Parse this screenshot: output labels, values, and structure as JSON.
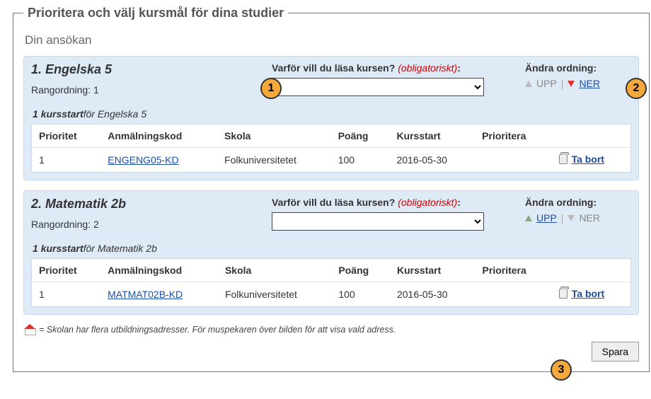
{
  "page": {
    "legend": "Prioritera och välj kursmål för dina studier",
    "subheading": "Din ansökan",
    "footnote_text": "= Skolan har flera utbildningsadresser. För muspekaren över bilden för att visa vald adress.",
    "save_label": "Spara"
  },
  "labels": {
    "question": "Varför vill du läsa kursen?",
    "obligatory": "(obligatoriskt)",
    "change_order": "Ändra ordning:",
    "up": "UPP",
    "down": "NER",
    "rank_prefix": "Rangordning:",
    "remove": "Ta bort",
    "kursstart_count_word": "kursstart",
    "kursstart_for": "för"
  },
  "columns": {
    "priority": "Prioritet",
    "code": "Anmälningskod",
    "school": "Skola",
    "points": "Poäng",
    "start": "Kursstart",
    "prioritize": "Prioritera"
  },
  "courses": [
    {
      "index": "1",
      "title": "1. Engelska 5",
      "name": "Engelska 5",
      "rank": "1",
      "kursstart_count": "1",
      "up_enabled": false,
      "down_enabled": true,
      "rows": [
        {
          "priority": "1",
          "code": "ENGENG05-KD",
          "school": "Folkuniversitetet",
          "points": "100",
          "start": "2016-05-30"
        }
      ]
    },
    {
      "index": "2",
      "title": "2. Matematik 2b",
      "name": "Matematik 2b",
      "rank": "2",
      "kursstart_count": "1",
      "up_enabled": true,
      "down_enabled": false,
      "rows": [
        {
          "priority": "1",
          "code": "MATMAT02B-KD",
          "school": "Folkuniversitetet",
          "points": "100",
          "start": "2016-05-30"
        }
      ]
    }
  ],
  "callouts": {
    "c1": "1",
    "c2": "2",
    "c3": "3"
  }
}
